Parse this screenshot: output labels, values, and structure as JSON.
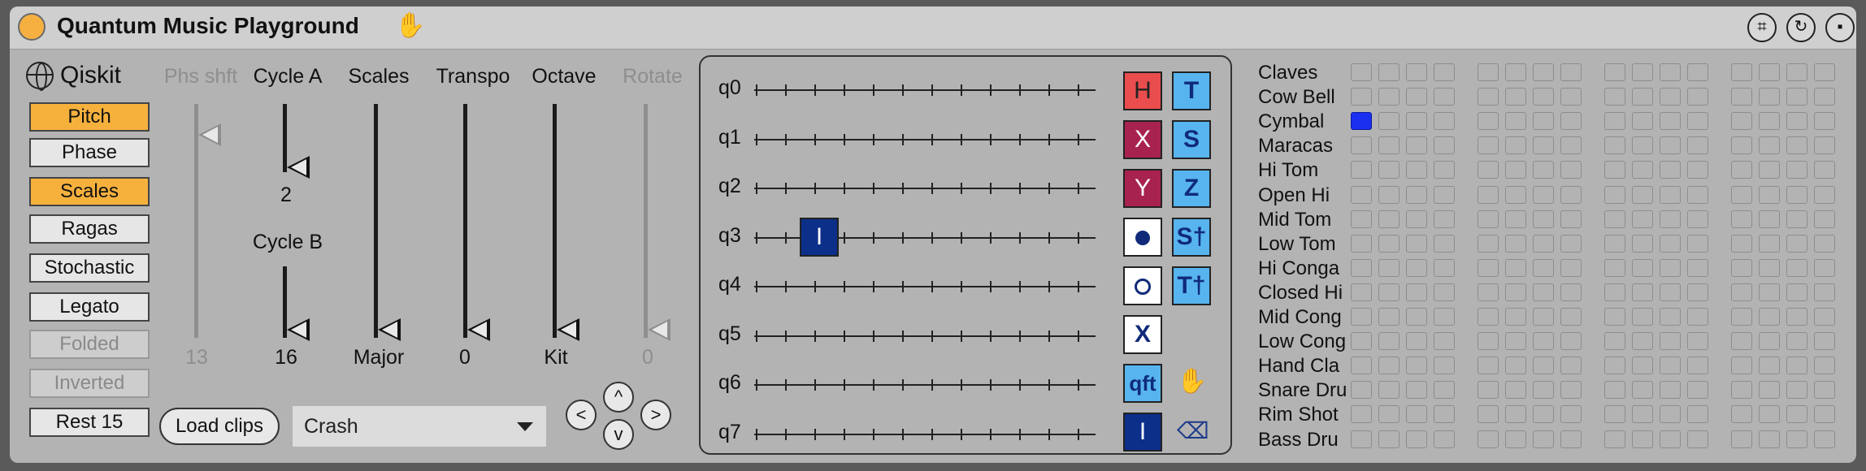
{
  "title": "Quantum Music Playground",
  "titlebar_icons": [
    "map-icon",
    "sync-icon",
    "save-icon"
  ],
  "logo_text": "Qiskit",
  "modes": [
    {
      "label": "Pitch",
      "active": true,
      "enabled": true
    },
    {
      "label": "Phase",
      "active": false,
      "enabled": true
    },
    {
      "label": "Scales",
      "active": true,
      "enabled": true
    },
    {
      "label": "Ragas",
      "active": false,
      "enabled": true
    },
    {
      "label": "Stochastic",
      "active": false,
      "enabled": true
    },
    {
      "label": "Legato",
      "active": false,
      "enabled": true
    },
    {
      "label": "Folded",
      "active": false,
      "enabled": false
    },
    {
      "label": "Inverted",
      "active": false,
      "enabled": false
    },
    {
      "label": "Rest 15",
      "active": false,
      "enabled": true
    }
  ],
  "sliders": {
    "phs_shft": {
      "label": "Phs shft",
      "value": "13",
      "enabled": false
    },
    "cycle_a": {
      "label": "Cycle A",
      "value": "2"
    },
    "cycle_b": {
      "label": "Cycle B",
      "value": "16"
    },
    "scales": {
      "label": "Scales",
      "value": "Major"
    },
    "transpo": {
      "label": "Transpo",
      "value": "0"
    },
    "octave": {
      "label": "Octave",
      "value": "Kit"
    },
    "rotate": {
      "label": "Rotate",
      "value": "0",
      "enabled": false
    }
  },
  "load_clips": "Load clips",
  "clip_dropdown": {
    "selected": "Crash"
  },
  "nav": {
    "left": "<",
    "up": "^",
    "right": ">",
    "down": "v"
  },
  "qubits": [
    "q0",
    "q1",
    "q2",
    "q3",
    "q4",
    "q5",
    "q6",
    "q7"
  ],
  "placed_gates": [
    {
      "qubit": "q3",
      "step": 2,
      "label": "I"
    }
  ],
  "palette": {
    "h": "H",
    "t": "T",
    "x": "X",
    "s": "S",
    "y": "Y",
    "z": "Z",
    "control": "control-dot",
    "sdg": "S†",
    "anticontrol": "anti-control-dot",
    "tdg": "T†",
    "measure": "X",
    "qft": "qft",
    "i": "I",
    "hand": "hand-icon",
    "delete": "backspace-icon"
  },
  "drums": [
    "Claves",
    "Cow Bell",
    "Cymbal",
    "Maracas",
    "Hi Tom",
    "Open Hi",
    "Mid Tom",
    "Low Tom",
    "Hi Conga",
    "Closed Hi",
    "Mid Cong",
    "Low Cong",
    "Hand Cla",
    "Snare Dru",
    "Rim Shot",
    "Bass Dru"
  ],
  "drum_grid": {
    "columns": 16,
    "active_cells": [
      {
        "row": 2,
        "col": 0
      }
    ]
  },
  "colors": {
    "accent": "#f6b13d",
    "h_gate": "#ea4d4d",
    "xy_gate": "#a8224f",
    "blue_gate": "#57b4ee",
    "navy_gate": "#0c2f8a",
    "active_cell": "#1b2ff0"
  }
}
